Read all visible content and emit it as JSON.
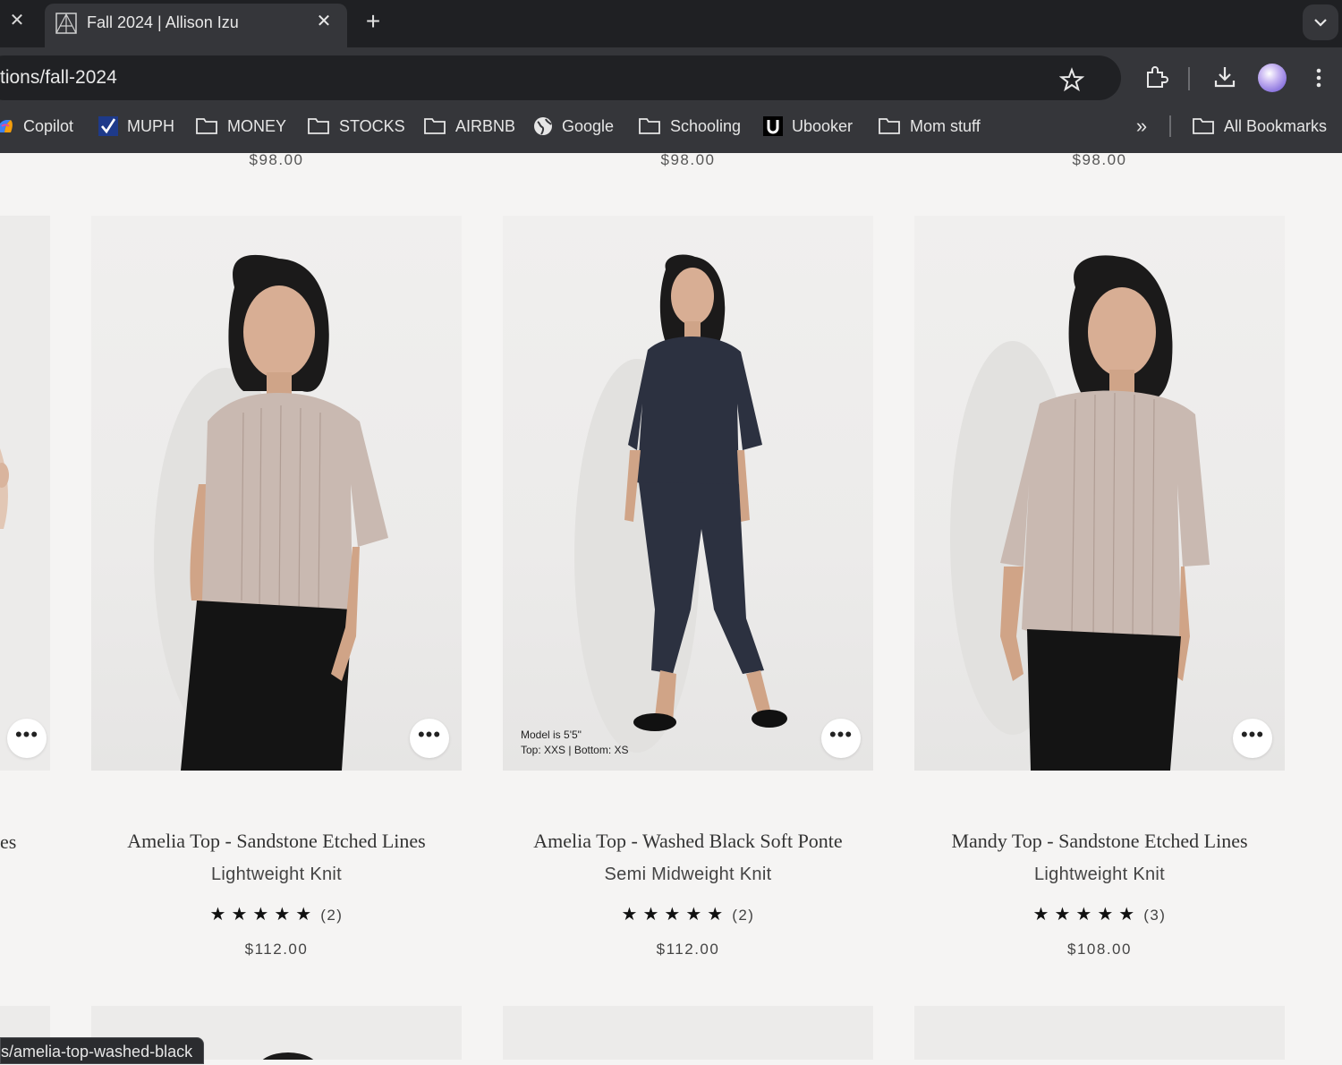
{
  "browser": {
    "tab": {
      "title": "Fall 2024 | Allison Izu"
    },
    "omnibox": {
      "url": "tions/fall-2024"
    },
    "bookmarks": [
      {
        "label": "Copilot",
        "icon": "copilot-icon"
      },
      {
        "label": "MUPH",
        "icon": "checkmark-icon"
      },
      {
        "label": "MONEY",
        "icon": "folder-icon"
      },
      {
        "label": "STOCKS",
        "icon": "folder-icon"
      },
      {
        "label": "AIRBNB",
        "icon": "folder-icon"
      },
      {
        "label": "Google",
        "icon": "globe-icon"
      },
      {
        "label": "Schooling",
        "icon": "folder-icon"
      },
      {
        "label": "Ubooker",
        "icon": "ubooker-icon"
      },
      {
        "label": "Mom stuff",
        "icon": "folder-icon"
      }
    ],
    "all_bookmarks_label": "All Bookmarks",
    "status_url": "s/amelia-top-washed-black"
  },
  "page": {
    "previous_row_prices": [
      "$98.00",
      "$98.00",
      "$98.00"
    ],
    "left_partial_name_tail": "es",
    "products": [
      {
        "name": "Amelia Top - Sandstone Etched Lines",
        "fabric": "Lightweight Knit",
        "stars": "★★★★★",
        "review_count": "(2)",
        "rating": 5,
        "price": "$112.00",
        "top_color": "#c9b9b1",
        "bottom_color": "#141414"
      },
      {
        "name": "Amelia Top - Washed Black Soft Ponte",
        "fabric": "Semi Midweight Knit",
        "stars": "★★★★★",
        "review_count": "(2)",
        "rating": 5,
        "price": "$112.00",
        "model_note_line1": "Model is 5'5\"",
        "model_note_line2": "Top: XXS | Bottom: XS",
        "top_color": "#2c3140",
        "bottom_color": "#2c3140"
      },
      {
        "name": "Mandy Top - Sandstone Etched Lines",
        "fabric": "Lightweight Knit",
        "stars": "★★★★★",
        "review_count": "(3)",
        "rating": 5,
        "price": "$108.00",
        "top_color": "#c9b9b1",
        "bottom_color": "#141414"
      }
    ],
    "more_button_glyph": "•••"
  }
}
